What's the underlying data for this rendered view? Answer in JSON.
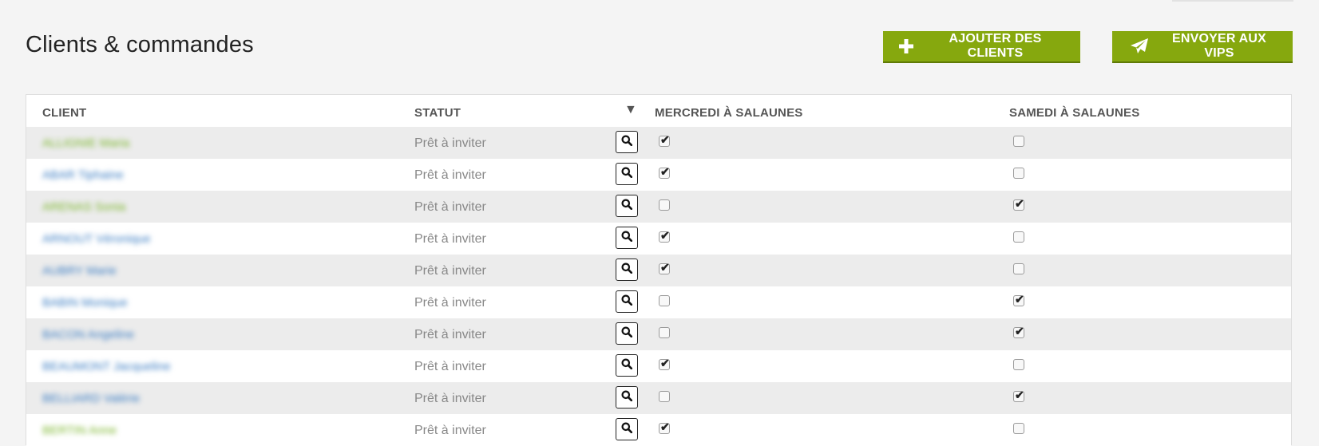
{
  "page": {
    "title": "Clients & commandes"
  },
  "toolbar": {
    "add_label": "AJOUTER DES CLIENTS",
    "send_label": "ENVOYER AUX VIPS",
    "accent": "#86a80e"
  },
  "table": {
    "headers": {
      "client": "CLIENT",
      "statut": "STATUT",
      "filter_icon": "▼",
      "mercredi": "MERCREDI À SALAUNES",
      "samedi": "SAMEDI À SALAUNES"
    },
    "rows": [
      {
        "client": "ALLIGNIE Maria",
        "color": "green",
        "status": "Prêt à inviter",
        "mercredi": true,
        "samedi": false
      },
      {
        "client": "ABAR Tiphaine",
        "color": "blue",
        "status": "Prêt à inviter",
        "mercredi": true,
        "samedi": false
      },
      {
        "client": "ARENAS Sonia",
        "color": "green",
        "status": "Prêt à inviter",
        "mercredi": false,
        "samedi": true
      },
      {
        "client": "ARNOUT Véronique",
        "color": "blue",
        "status": "Prêt à inviter",
        "mercredi": true,
        "samedi": false
      },
      {
        "client": "AUBRY Marie",
        "color": "blue",
        "status": "Prêt à inviter",
        "mercredi": true,
        "samedi": false
      },
      {
        "client": "BABIN Monique",
        "color": "blue",
        "status": "Prêt à inviter",
        "mercredi": false,
        "samedi": true
      },
      {
        "client": "BACON Angeline",
        "color": "blue",
        "status": "Prêt à inviter",
        "mercredi": false,
        "samedi": true
      },
      {
        "client": "BEAUMONT Jacqueline",
        "color": "blue",
        "status": "Prêt à inviter",
        "mercredi": true,
        "samedi": false
      },
      {
        "client": "BELLIARD Valérie",
        "color": "blue",
        "status": "Prêt à inviter",
        "mercredi": false,
        "samedi": true
      },
      {
        "client": "BERTIN Anne",
        "color": "green",
        "status": "Prêt à inviter",
        "mercredi": true,
        "samedi": false
      }
    ]
  }
}
